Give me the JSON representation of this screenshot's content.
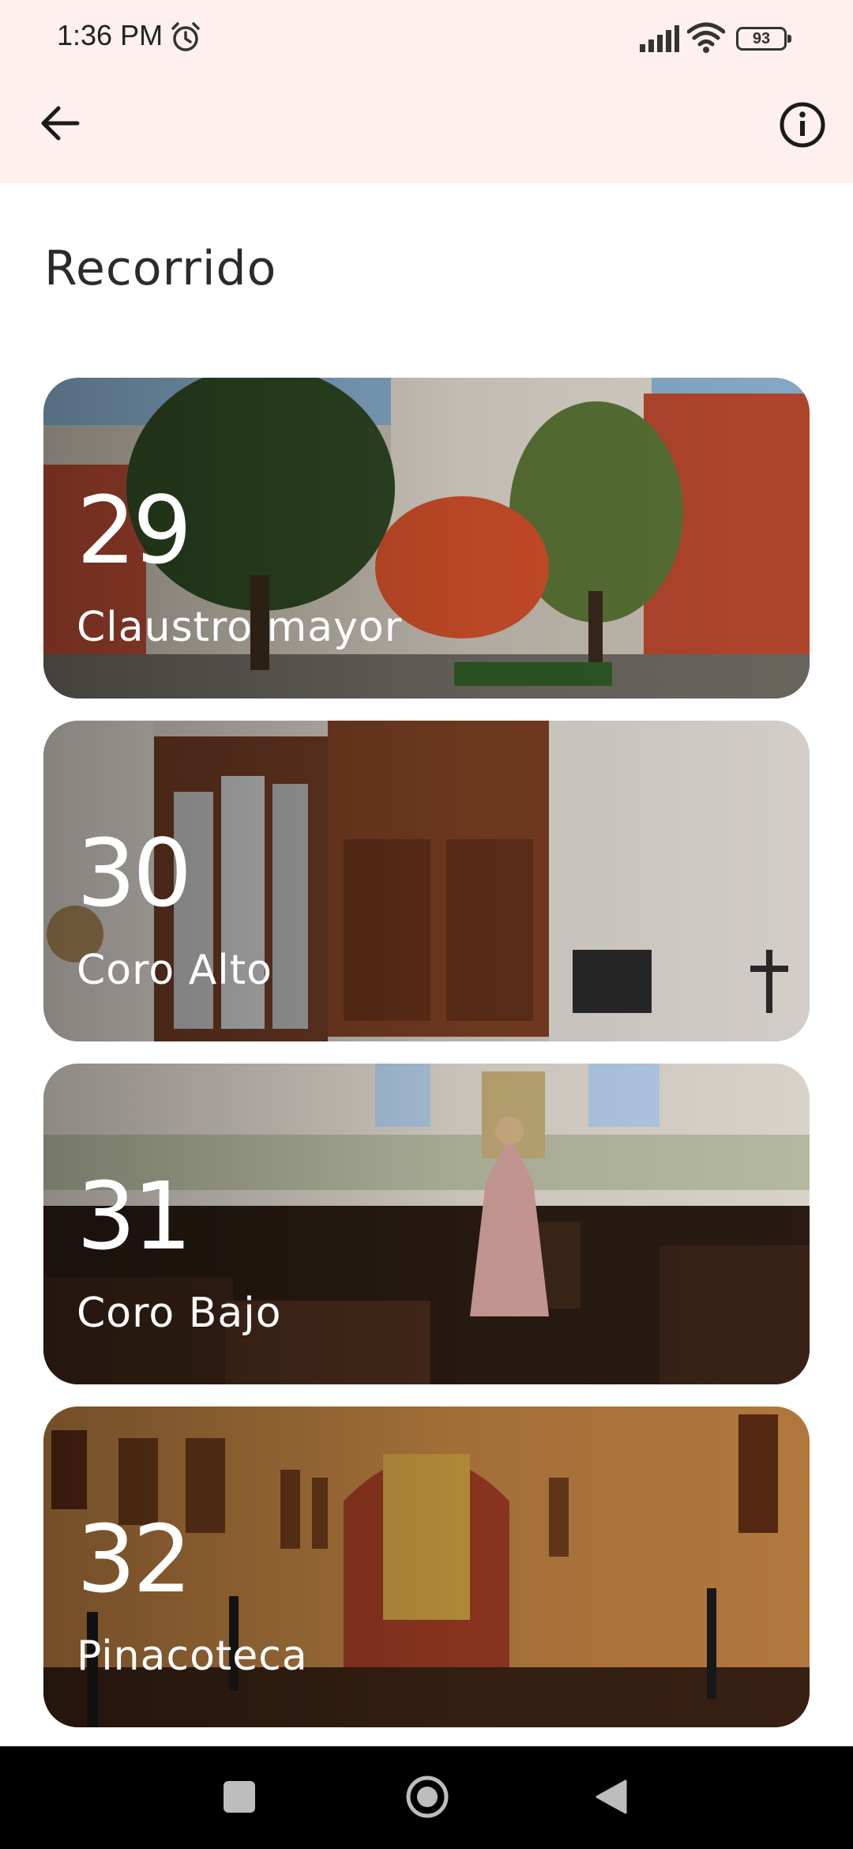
{
  "status_bar": {
    "time": "1:36 PM",
    "battery": "93",
    "icons": [
      "alarm-icon",
      "signal-icon",
      "wifi-icon",
      "battery-icon"
    ]
  },
  "app_bar": {
    "back_icon": "arrow-left-icon",
    "info_icon": "info-icon"
  },
  "page": {
    "title": "Recorrido"
  },
  "cards": [
    {
      "number": "29",
      "title": "Claustro mayor"
    },
    {
      "number": "30",
      "title": "Coro Alto"
    },
    {
      "number": "31",
      "title": "Coro Bajo"
    },
    {
      "number": "32",
      "title": "Pinacoteca"
    }
  ],
  "nav_bar": {
    "icons": [
      "recents-square-icon",
      "home-circle-icon",
      "back-triangle-icon"
    ]
  },
  "colors": {
    "app_bar_bg": "#fdf0ef",
    "nav_bar_bg": "#000000",
    "text_dark": "#2b2b2b"
  }
}
